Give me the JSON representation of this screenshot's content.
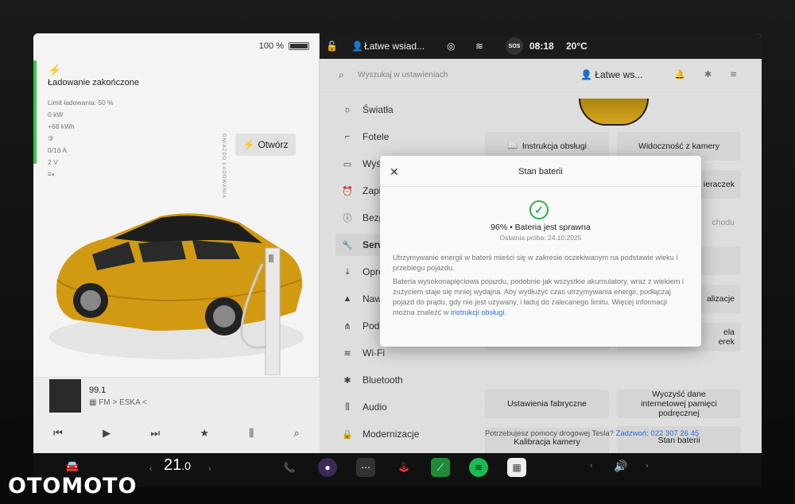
{
  "left": {
    "battery_pct": "100 %",
    "charge_status": "Ładowanie zakończone",
    "charge_details": [
      "Limit ładowania: 50 %",
      "0 kW",
      "+68 kWh",
      "0/16 A",
      "2 V"
    ],
    "open_label": "Otwórz",
    "vertical_label": "GNIAZDO ŁADOWANIA",
    "media": {
      "station": "99.1",
      "source": "FM > ESKA <"
    }
  },
  "statusbar": {
    "profile": "Łatwe wsiad...",
    "sos": "SOS",
    "time": "08:18",
    "temp": "20°C"
  },
  "search": {
    "placeholder": "Wyszukaj w ustawieniach",
    "user": "Łatwe ws..."
  },
  "menu": [
    {
      "icon": "light-icon",
      "label": "Światła"
    },
    {
      "icon": "seat-icon",
      "label": "Fotele"
    },
    {
      "icon": "display-icon",
      "label": "Wyś"
    },
    {
      "icon": "clock-icon",
      "label": "Zapla"
    },
    {
      "icon": "warning-icon",
      "label": "Bezp"
    },
    {
      "icon": "wrench-icon",
      "label": "Serw"
    },
    {
      "icon": "download-icon",
      "label": "Opro"
    },
    {
      "icon": "navigation-icon",
      "label": "Nawi"
    },
    {
      "icon": "road-icon",
      "label": "Podr"
    },
    {
      "icon": "wifi-icon",
      "label": "Wi-Fi"
    },
    {
      "icon": "bluetooth-icon",
      "label": "Bluetooth"
    },
    {
      "icon": "audio-icon",
      "label": "Audio"
    },
    {
      "icon": "lock-icon",
      "label": "Modernizacje"
    }
  ],
  "grid": {
    "manual": "Instrukcja obsługi",
    "camera_view": "Widoczność z kamery",
    "wipers": "ieraczek",
    "chodu": "chodu",
    "lizacje": "alizacje",
    "ela": "ela",
    "erek": "erek",
    "factory": "Ustawienia fabryczne",
    "clear_memory": "Wyczyść dane internetowej pamięci podręcznej",
    "calib": "Kalibracja kamery",
    "battery": "Stan baterii"
  },
  "help": {
    "text": "Potrzebujesz pomocy drogowej Tesla?",
    "link": "Zadzwoń: 022 307 26 45"
  },
  "modal": {
    "title": "Stan baterii",
    "health": "96% • Bateria jest sprawna",
    "last_test": "Ostatnia próba: 24.10.2025",
    "p1": "Utrzymywanie energii w baterii mieści się w zakresie oczekiwanym na podstawie wieku i przebiegu pojazdu.",
    "p2": "Bateria wysokonapięciowa pojazdu, podobnie jak wszystkie akumulatory, wraz z wiekiem i zużyciem staje się mniej wydajna. Aby wydłużyć czas utrzymywania energii, podłączaj pojazd do prądu, gdy nie jest używany, i ładuj do zalecanego limitu. Więcej informacji można znaleźć w",
    "p2_link": "instrukcji obsługi",
    "p2_end": "."
  },
  "taskbar": {
    "temp_int": "21",
    "temp_dec": ".0"
  },
  "watermark": "OTOMOTO"
}
